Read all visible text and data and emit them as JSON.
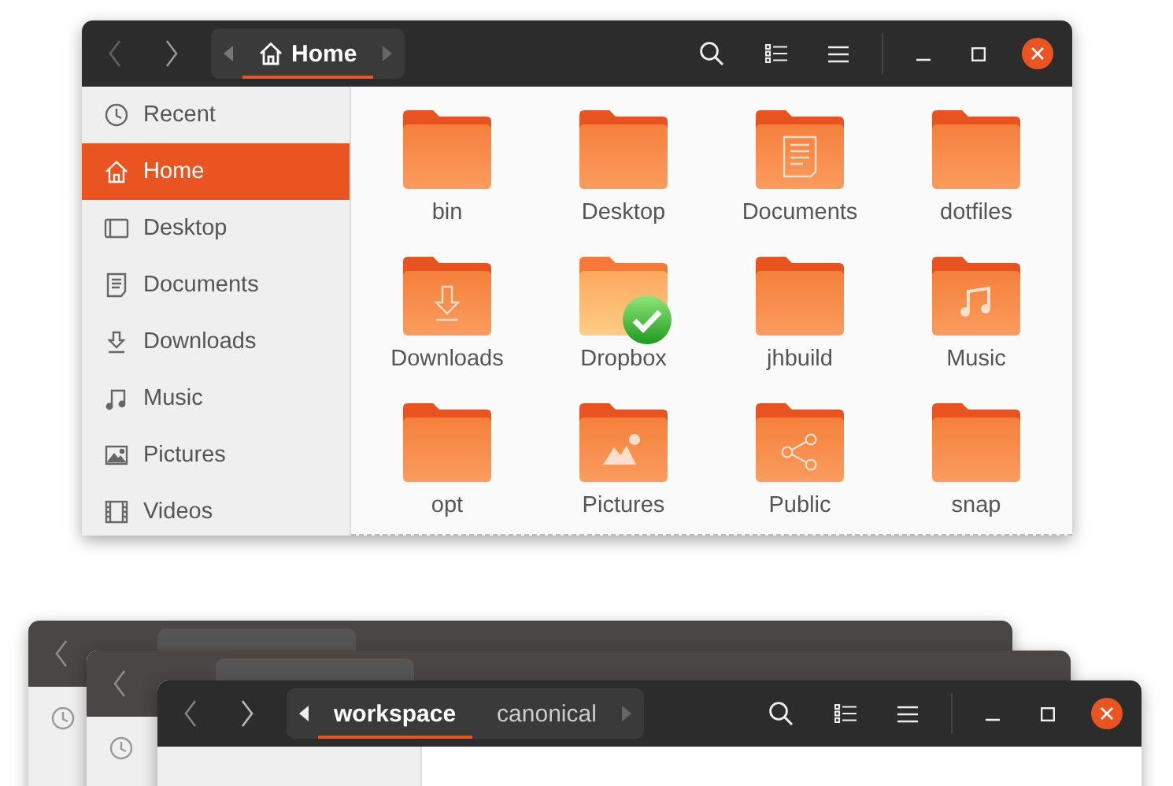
{
  "window": {
    "path": [
      {
        "label": "Home",
        "icon": true,
        "selected": true
      }
    ],
    "sidebar": [
      {
        "label": "Recent",
        "kind": "recent",
        "selected": false
      },
      {
        "label": "Home",
        "kind": "home",
        "selected": true
      },
      {
        "label": "Desktop",
        "kind": "desktop",
        "selected": false
      },
      {
        "label": "Documents",
        "kind": "documents",
        "selected": false
      },
      {
        "label": "Downloads",
        "kind": "downloads",
        "selected": false
      },
      {
        "label": "Music",
        "kind": "music",
        "selected": false
      },
      {
        "label": "Pictures",
        "kind": "pictures",
        "selected": false
      },
      {
        "label": "Videos",
        "kind": "videos",
        "selected": false
      }
    ],
    "files": [
      {
        "name": "bin",
        "kind": "plain"
      },
      {
        "name": "Desktop",
        "kind": "plain"
      },
      {
        "name": "Documents",
        "kind": "document"
      },
      {
        "name": "dotfiles",
        "kind": "plain"
      },
      {
        "name": "Downloads",
        "kind": "download"
      },
      {
        "name": "Dropbox",
        "kind": "synced"
      },
      {
        "name": "jhbuild",
        "kind": "plain"
      },
      {
        "name": "Music",
        "kind": "music"
      },
      {
        "name": "opt",
        "kind": "plain"
      },
      {
        "name": "Pictures",
        "kind": "picture"
      },
      {
        "name": "Public",
        "kind": "share"
      },
      {
        "name": "snap",
        "kind": "plain"
      }
    ]
  },
  "stacked_windows": [
    {
      "kind": "back"
    },
    {
      "kind": "back"
    },
    {
      "kind": "front",
      "path": [
        {
          "label": "workspace",
          "selected": true
        },
        {
          "label": "canonical",
          "selected": false
        }
      ]
    }
  ]
}
